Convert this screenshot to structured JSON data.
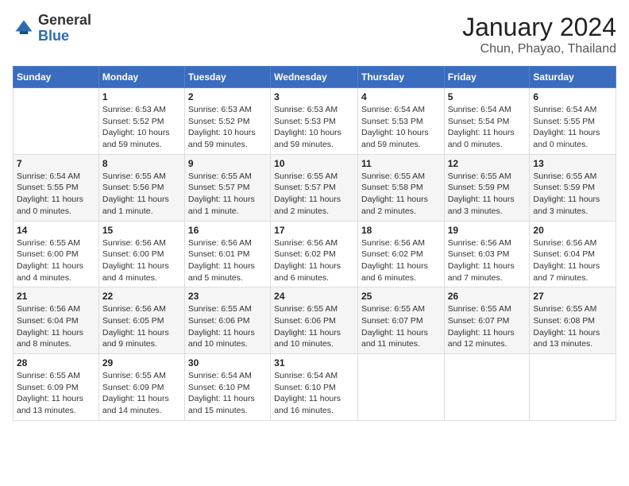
{
  "header": {
    "logo_general": "General",
    "logo_blue": "Blue",
    "title": "January 2024",
    "subtitle": "Chun, Phayao, Thailand"
  },
  "weekdays": [
    "Sunday",
    "Monday",
    "Tuesday",
    "Wednesday",
    "Thursday",
    "Friday",
    "Saturday"
  ],
  "weeks": [
    [
      {
        "day": "",
        "info": ""
      },
      {
        "day": "1",
        "info": "Sunrise: 6:53 AM\nSunset: 5:52 PM\nDaylight: 10 hours\nand 59 minutes."
      },
      {
        "day": "2",
        "info": "Sunrise: 6:53 AM\nSunset: 5:52 PM\nDaylight: 10 hours\nand 59 minutes."
      },
      {
        "day": "3",
        "info": "Sunrise: 6:53 AM\nSunset: 5:53 PM\nDaylight: 10 hours\nand 59 minutes."
      },
      {
        "day": "4",
        "info": "Sunrise: 6:54 AM\nSunset: 5:53 PM\nDaylight: 10 hours\nand 59 minutes."
      },
      {
        "day": "5",
        "info": "Sunrise: 6:54 AM\nSunset: 5:54 PM\nDaylight: 11 hours\nand 0 minutes."
      },
      {
        "day": "6",
        "info": "Sunrise: 6:54 AM\nSunset: 5:55 PM\nDaylight: 11 hours\nand 0 minutes."
      }
    ],
    [
      {
        "day": "7",
        "info": "Sunrise: 6:54 AM\nSunset: 5:55 PM\nDaylight: 11 hours\nand 0 minutes."
      },
      {
        "day": "8",
        "info": "Sunrise: 6:55 AM\nSunset: 5:56 PM\nDaylight: 11 hours\nand 1 minute."
      },
      {
        "day": "9",
        "info": "Sunrise: 6:55 AM\nSunset: 5:57 PM\nDaylight: 11 hours\nand 1 minute."
      },
      {
        "day": "10",
        "info": "Sunrise: 6:55 AM\nSunset: 5:57 PM\nDaylight: 11 hours\nand 2 minutes."
      },
      {
        "day": "11",
        "info": "Sunrise: 6:55 AM\nSunset: 5:58 PM\nDaylight: 11 hours\nand 2 minutes."
      },
      {
        "day": "12",
        "info": "Sunrise: 6:55 AM\nSunset: 5:59 PM\nDaylight: 11 hours\nand 3 minutes."
      },
      {
        "day": "13",
        "info": "Sunrise: 6:55 AM\nSunset: 5:59 PM\nDaylight: 11 hours\nand 3 minutes."
      }
    ],
    [
      {
        "day": "14",
        "info": "Sunrise: 6:55 AM\nSunset: 6:00 PM\nDaylight: 11 hours\nand 4 minutes."
      },
      {
        "day": "15",
        "info": "Sunrise: 6:56 AM\nSunset: 6:00 PM\nDaylight: 11 hours\nand 4 minutes."
      },
      {
        "day": "16",
        "info": "Sunrise: 6:56 AM\nSunset: 6:01 PM\nDaylight: 11 hours\nand 5 minutes."
      },
      {
        "day": "17",
        "info": "Sunrise: 6:56 AM\nSunset: 6:02 PM\nDaylight: 11 hours\nand 6 minutes."
      },
      {
        "day": "18",
        "info": "Sunrise: 6:56 AM\nSunset: 6:02 PM\nDaylight: 11 hours\nand 6 minutes."
      },
      {
        "day": "19",
        "info": "Sunrise: 6:56 AM\nSunset: 6:03 PM\nDaylight: 11 hours\nand 7 minutes."
      },
      {
        "day": "20",
        "info": "Sunrise: 6:56 AM\nSunset: 6:04 PM\nDaylight: 11 hours\nand 7 minutes."
      }
    ],
    [
      {
        "day": "21",
        "info": "Sunrise: 6:56 AM\nSunset: 6:04 PM\nDaylight: 11 hours\nand 8 minutes."
      },
      {
        "day": "22",
        "info": "Sunrise: 6:56 AM\nSunset: 6:05 PM\nDaylight: 11 hours\nand 9 minutes."
      },
      {
        "day": "23",
        "info": "Sunrise: 6:55 AM\nSunset: 6:06 PM\nDaylight: 11 hours\nand 10 minutes."
      },
      {
        "day": "24",
        "info": "Sunrise: 6:55 AM\nSunset: 6:06 PM\nDaylight: 11 hours\nand 10 minutes."
      },
      {
        "day": "25",
        "info": "Sunrise: 6:55 AM\nSunset: 6:07 PM\nDaylight: 11 hours\nand 11 minutes."
      },
      {
        "day": "26",
        "info": "Sunrise: 6:55 AM\nSunset: 6:07 PM\nDaylight: 11 hours\nand 12 minutes."
      },
      {
        "day": "27",
        "info": "Sunrise: 6:55 AM\nSunset: 6:08 PM\nDaylight: 11 hours\nand 13 minutes."
      }
    ],
    [
      {
        "day": "28",
        "info": "Sunrise: 6:55 AM\nSunset: 6:09 PM\nDaylight: 11 hours\nand 13 minutes."
      },
      {
        "day": "29",
        "info": "Sunrise: 6:55 AM\nSunset: 6:09 PM\nDaylight: 11 hours\nand 14 minutes."
      },
      {
        "day": "30",
        "info": "Sunrise: 6:54 AM\nSunset: 6:10 PM\nDaylight: 11 hours\nand 15 minutes."
      },
      {
        "day": "31",
        "info": "Sunrise: 6:54 AM\nSunset: 6:10 PM\nDaylight: 11 hours\nand 16 minutes."
      },
      {
        "day": "",
        "info": ""
      },
      {
        "day": "",
        "info": ""
      },
      {
        "day": "",
        "info": ""
      }
    ]
  ]
}
